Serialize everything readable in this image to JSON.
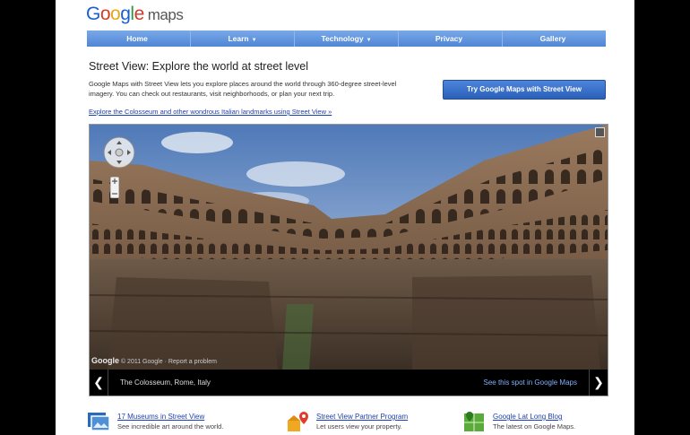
{
  "logo": {
    "g1": "G",
    "g2": "o",
    "g3": "o",
    "g4": "g",
    "g5": "l",
    "g6": "e",
    "maps": "maps"
  },
  "nav": [
    {
      "label": "Home",
      "arrow": ""
    },
    {
      "label": "Learn",
      "arrow": "▼"
    },
    {
      "label": "Technology",
      "arrow": "▼"
    },
    {
      "label": "Privacy",
      "arrow": ""
    },
    {
      "label": "Gallery",
      "arrow": ""
    }
  ],
  "main": {
    "title": "Street View: Explore the world at street level",
    "description": "Google Maps with Street View lets you explore places around the world through 360-degree street-level imagery. You can check out restaurants, visit neighborhoods, or plan your next trip.",
    "cta_label": "Try Google Maps with Street View",
    "explore_link": "Explore the Colosseum and other wondrous Italian landmarks using Street View »"
  },
  "viewer": {
    "watermark_logo": "Google",
    "watermark_text": "© 2011 Google · Report a problem",
    "caption": "The Colosseum, Rome, Italy",
    "caption_link": "See this spot in Google Maps",
    "prev": "❮",
    "next": "❯"
  },
  "footer": [
    {
      "icon": "museum-photo-icon",
      "link": "17 Museums in Street View",
      "sub": "See incredible art around the world."
    },
    {
      "icon": "partner-pin-icon",
      "link": "Street View Partner Program",
      "sub": "Let users view your property."
    },
    {
      "icon": "blog-map-icon",
      "link": "Google Lat Long Blog",
      "sub": "The latest on Google Maps."
    }
  ],
  "colors": {
    "nav": "#5b8fdc",
    "link": "#1a3fb5",
    "cta": "#3a70c8"
  }
}
